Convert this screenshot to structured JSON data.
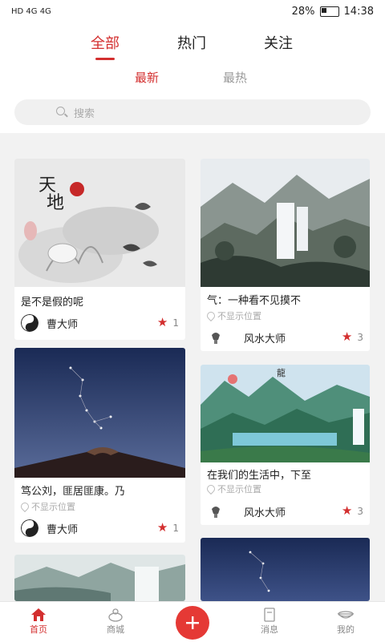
{
  "status_bar": {
    "network": "HD 4G 4G",
    "battery": "28%",
    "time": "14:38"
  },
  "tabs": [
    "全部",
    "热门",
    "关注"
  ],
  "subtabs": [
    "最新",
    "最热"
  ],
  "search": {
    "placeholder": "搜索"
  },
  "cards": [
    {
      "title": "是不是假的呢",
      "author": "曹大师",
      "likes": "1"
    },
    {
      "title": "气：一种看不见摸不",
      "location": "不显示位置",
      "author": "风水大师",
      "likes": "3"
    },
    {
      "title": "笃公刘，匪居匪康。乃",
      "location": "不显示位置",
      "author": "曹大师",
      "likes": "1"
    },
    {
      "title": "在我们的生活中，下至",
      "location": "不显示位置",
      "author": "风水大师",
      "likes": "3"
    }
  ],
  "bottom_nav": [
    "首页",
    "商城",
    "消息",
    "我的"
  ],
  "colors": {
    "accent": "#d32f2f"
  }
}
